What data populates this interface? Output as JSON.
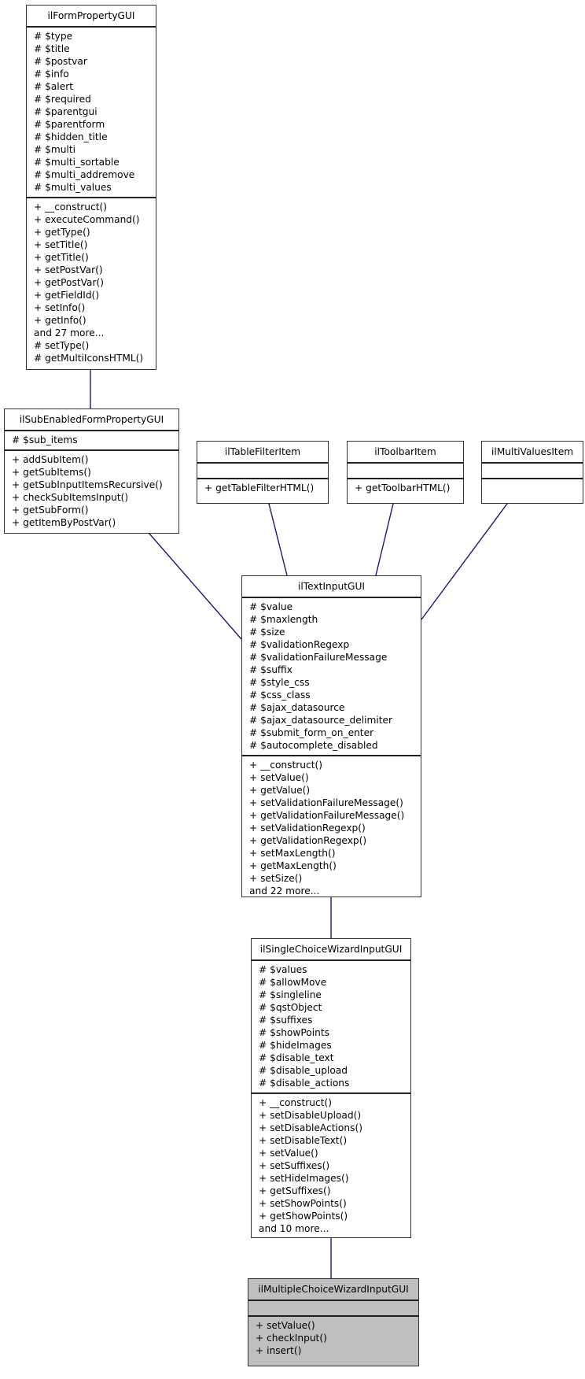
{
  "diagram": {
    "type": "uml-class-inheritance",
    "colors": {
      "edge": "#1a1a6e",
      "focus_fill": "#bfbfbf",
      "box_border": "#333333"
    },
    "classes": {
      "formProperty": {
        "name": "ilFormPropertyGUI",
        "attributes": [
          "# $type",
          "# $title",
          "# $postvar",
          "# $info",
          "# $alert",
          "# $required",
          "# $parentgui",
          "# $parentform",
          "# $hidden_title",
          "# $multi",
          "# $multi_sortable",
          "# $multi_addremove",
          "# $multi_values"
        ],
        "methods": [
          "+ __construct()",
          "+ executeCommand()",
          "+ getType()",
          "+ setTitle()",
          "+ getTitle()",
          "+ setPostVar()",
          "+ getPostVar()",
          "+ getFieldId()",
          "+ setInfo()",
          "+ getInfo()",
          "and 27 more...",
          "# setType()",
          "# getMultiIconsHTML()"
        ]
      },
      "subEnabled": {
        "name": "ilSubEnabledFormPropertyGUI",
        "attributes": [
          "# $sub_items"
        ],
        "methods": [
          "+ addSubItem()",
          "+ getSubItems()",
          "+ getSubInputItemsRecursive()",
          "+ checkSubItemsInput()",
          "+ getSubForm()",
          "+ getItemByPostVar()"
        ]
      },
      "tableFilter": {
        "name": "ilTableFilterItem",
        "attributes": [],
        "methods": [
          "+ getTableFilterHTML()"
        ]
      },
      "toolbar": {
        "name": "ilToolbarItem",
        "attributes": [],
        "methods": [
          "+ getToolbarHTML()"
        ]
      },
      "multiValues": {
        "name": "ilMultiValuesItem",
        "attributes": [],
        "methods": []
      },
      "textInput": {
        "name": "ilTextInputGUI",
        "attributes": [
          "# $value",
          "# $maxlength",
          "# $size",
          "# $validationRegexp",
          "# $validationFailureMessage",
          "# $suffix",
          "# $style_css",
          "# $css_class",
          "# $ajax_datasource",
          "# $ajax_datasource_delimiter",
          "# $submit_form_on_enter",
          "# $autocomplete_disabled"
        ],
        "methods": [
          "+ __construct()",
          "+ setValue()",
          "+ getValue()",
          "+ setValidationFailureMessage()",
          "+ getValidationFailureMessage()",
          "+ setValidationRegexp()",
          "+ getValidationRegexp()",
          "+ setMaxLength()",
          "+ getMaxLength()",
          "+ setSize()",
          "and 22 more..."
        ]
      },
      "singleChoice": {
        "name": "ilSingleChoiceWizardInputGUI",
        "attributes": [
          "# $values",
          "# $allowMove",
          "# $singleline",
          "# $qstObject",
          "# $suffixes",
          "# $showPoints",
          "# $hideImages",
          "# $disable_text",
          "# $disable_upload",
          "# $disable_actions"
        ],
        "methods": [
          "+ __construct()",
          "+ setDisableUpload()",
          "+ setDisableActions()",
          "+ setDisableText()",
          "+ setValue()",
          "+ setSuffixes()",
          "+ setHideImages()",
          "+ getSuffixes()",
          "+ setShowPoints()",
          "+ getShowPoints()",
          "and 10 more..."
        ]
      },
      "multipleChoice": {
        "name": "ilMultipleChoiceWizardInputGUI",
        "attributes": [],
        "methods": [
          "+ setValue()",
          "+ checkInput()",
          "+ insert()"
        ]
      }
    },
    "inheritance": [
      {
        "child": "ilSubEnabledFormPropertyGUI",
        "parent": "ilFormPropertyGUI"
      },
      {
        "child": "ilTextInputGUI",
        "parent": "ilSubEnabledFormPropertyGUI"
      },
      {
        "child": "ilTextInputGUI",
        "parent": "ilTableFilterItem"
      },
      {
        "child": "ilTextInputGUI",
        "parent": "ilToolbarItem"
      },
      {
        "child": "ilTextInputGUI",
        "parent": "ilMultiValuesItem"
      },
      {
        "child": "ilSingleChoiceWizardInputGUI",
        "parent": "ilTextInputGUI"
      },
      {
        "child": "ilMultipleChoiceWizardInputGUI",
        "parent": "ilSingleChoiceWizardInputGUI"
      }
    ]
  }
}
